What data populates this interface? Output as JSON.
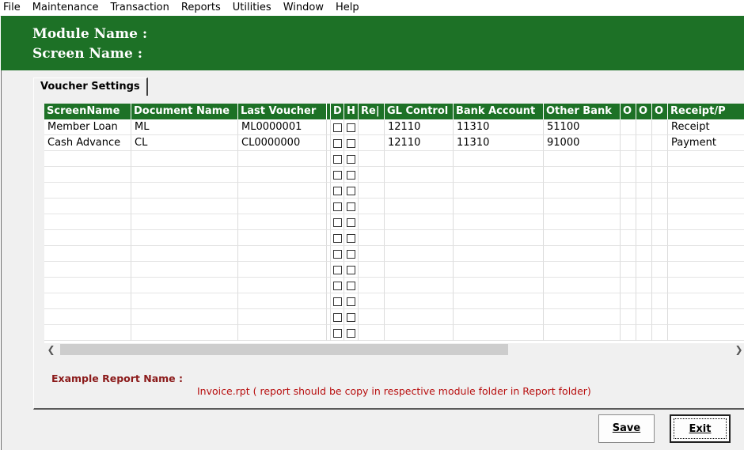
{
  "menu": {
    "items": [
      "File",
      "Maintenance",
      "Transaction",
      "Reports",
      "Utilities",
      "Window",
      "Help"
    ]
  },
  "header": {
    "module_label": "Module Name :",
    "screen_label": "Screen Name :"
  },
  "tab": {
    "label": "Voucher Settings"
  },
  "grid": {
    "columns": [
      "ScreenName",
      "Document Name",
      "Last Voucher",
      "D",
      "H",
      "Re|",
      "GL Control",
      "Bank Account",
      "Other Bank",
      "O",
      "O",
      "O",
      "Receipt/P"
    ],
    "rows": [
      {
        "screen": "Member Loan",
        "doc": "ML",
        "last": "ML0000001",
        "re": "",
        "gl": "12110",
        "bank": "11310",
        "other": "51100",
        "o1": "",
        "o2": "",
        "o3": "",
        "receipt": "Receipt"
      },
      {
        "screen": "Cash Advance",
        "doc": "CL",
        "last": "CL0000000",
        "re": "",
        "gl": "12110",
        "bank": "11310",
        "other": "91000",
        "o1": "",
        "o2": "",
        "o3": "",
        "receipt": "Payment"
      },
      {
        "screen": "",
        "doc": "",
        "last": "",
        "re": "",
        "gl": "",
        "bank": "",
        "other": "",
        "o1": "",
        "o2": "",
        "o3": "",
        "receipt": ""
      },
      {
        "screen": "",
        "doc": "",
        "last": "",
        "re": "",
        "gl": "",
        "bank": "",
        "other": "",
        "o1": "",
        "o2": "",
        "o3": "",
        "receipt": ""
      },
      {
        "screen": "",
        "doc": "",
        "last": "",
        "re": "",
        "gl": "",
        "bank": "",
        "other": "",
        "o1": "",
        "o2": "",
        "o3": "",
        "receipt": ""
      },
      {
        "screen": "",
        "doc": "",
        "last": "",
        "re": "",
        "gl": "",
        "bank": "",
        "other": "",
        "o1": "",
        "o2": "",
        "o3": "",
        "receipt": ""
      },
      {
        "screen": "",
        "doc": "",
        "last": "",
        "re": "",
        "gl": "",
        "bank": "",
        "other": "",
        "o1": "",
        "o2": "",
        "o3": "",
        "receipt": ""
      },
      {
        "screen": "",
        "doc": "",
        "last": "",
        "re": "",
        "gl": "",
        "bank": "",
        "other": "",
        "o1": "",
        "o2": "",
        "o3": "",
        "receipt": ""
      },
      {
        "screen": "",
        "doc": "",
        "last": "",
        "re": "",
        "gl": "",
        "bank": "",
        "other": "",
        "o1": "",
        "o2": "",
        "o3": "",
        "receipt": ""
      },
      {
        "screen": "",
        "doc": "",
        "last": "",
        "re": "",
        "gl": "",
        "bank": "",
        "other": "",
        "o1": "",
        "o2": "",
        "o3": "",
        "receipt": ""
      },
      {
        "screen": "",
        "doc": "",
        "last": "",
        "re": "",
        "gl": "",
        "bank": "",
        "other": "",
        "o1": "",
        "o2": "",
        "o3": "",
        "receipt": ""
      },
      {
        "screen": "",
        "doc": "",
        "last": "",
        "re": "",
        "gl": "",
        "bank": "",
        "other": "",
        "o1": "",
        "o2": "",
        "o3": "",
        "receipt": ""
      },
      {
        "screen": "",
        "doc": "",
        "last": "",
        "re": "",
        "gl": "",
        "bank": "",
        "other": "",
        "o1": "",
        "o2": "",
        "o3": "",
        "receipt": ""
      },
      {
        "screen": "",
        "doc": "",
        "last": "",
        "re": "",
        "gl": "",
        "bank": "",
        "other": "",
        "o1": "",
        "o2": "",
        "o3": "",
        "receipt": ""
      }
    ]
  },
  "scrollbar": {
    "left_icon": "chevron-left-icon",
    "right_icon": "chevron-right-icon"
  },
  "example": {
    "label": "Example Report Name :",
    "text": "Invoice.rpt ( report should be copy in respective module folder in Report folder)"
  },
  "buttons": {
    "save": {
      "label": "Save"
    },
    "exit": {
      "label": "Exit"
    }
  },
  "colors": {
    "header_green": "#1d7126",
    "example_label": "#8b1a1a",
    "example_text": "#b80f0f"
  }
}
